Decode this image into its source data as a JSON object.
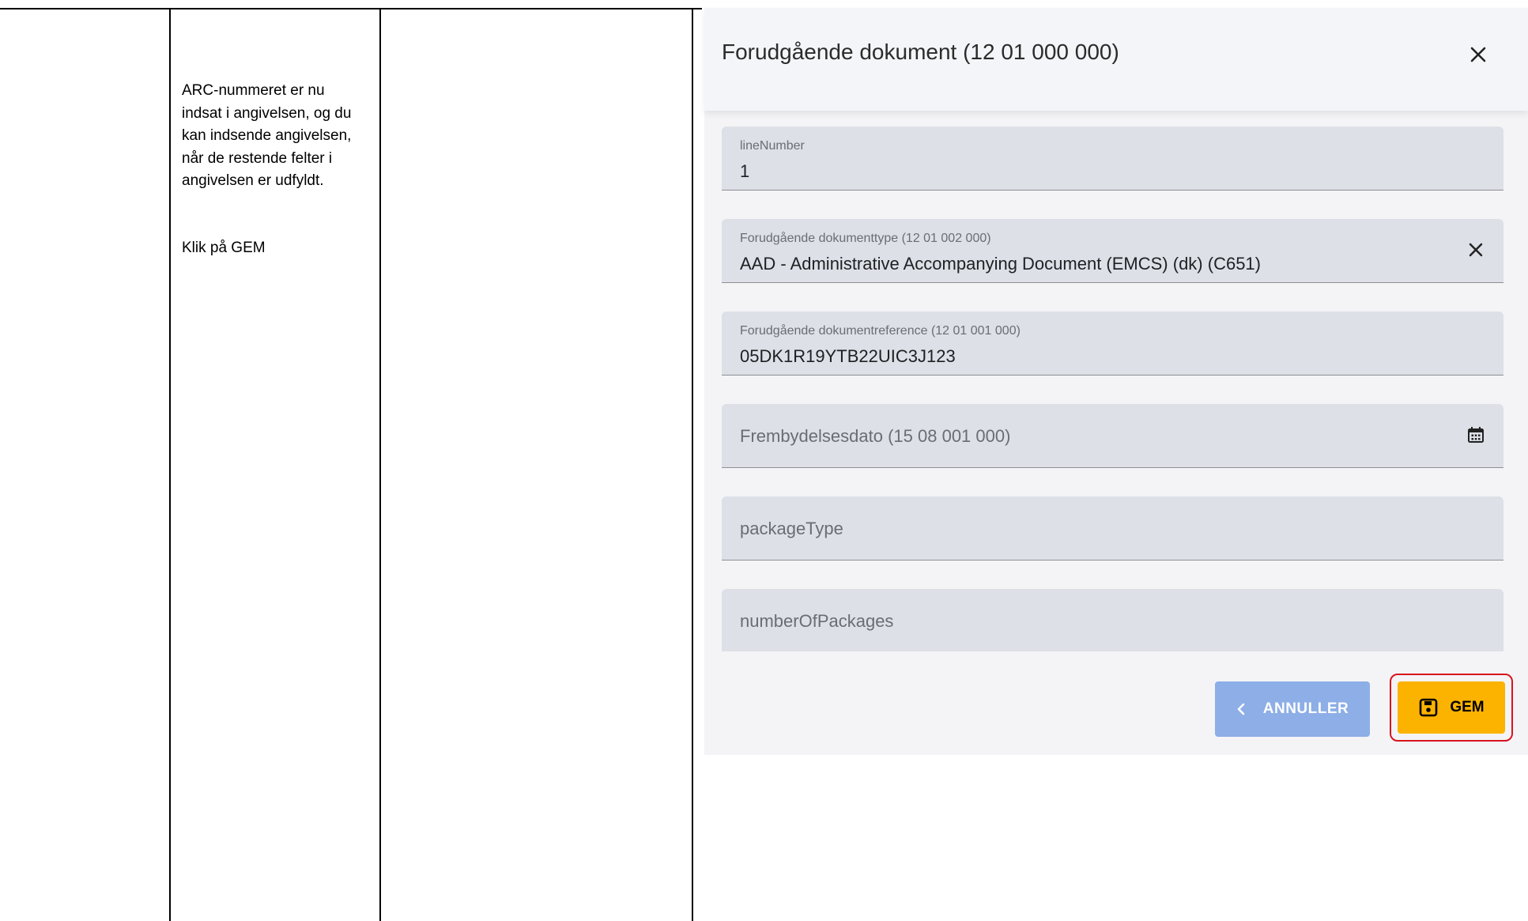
{
  "instructions": {
    "paragraph_1": "ARC-nummeret er nu indsat i angivelsen, og du kan indsende angivelsen, når de restende felter i angivelsen er udfyldt.",
    "paragraph_2": "Klik på GEM"
  },
  "dialog": {
    "title": "Forudgående dokument (12 01 000 000)",
    "fields": [
      {
        "label": "lineNumber",
        "value": "1"
      },
      {
        "label": "Forudgående dokumenttype (12 01 002 000)",
        "value": "AAD - Administrative Accompanying Document (EMCS) (dk) (C651)"
      },
      {
        "label": "Forudgående dokumentreference (12 01 001 000)",
        "value": "05DK1R19YTB22UIC3J123"
      },
      {
        "placeholder": "Frembydelsesdato (15 08 001 000)"
      },
      {
        "placeholder": "packageType"
      },
      {
        "placeholder": "numberOfPackages"
      }
    ],
    "buttons": {
      "cancel": "ANNULLER",
      "save": "GEM"
    }
  },
  "colors": {
    "save_button": "#fcb300",
    "cancel_button": "#8daee6",
    "highlight": "#d8141c",
    "field_background": "#dde0e7"
  },
  "icons": [
    "close-icon",
    "clear-icon",
    "calendar-icon",
    "chevron-left-icon",
    "save-icon"
  ]
}
